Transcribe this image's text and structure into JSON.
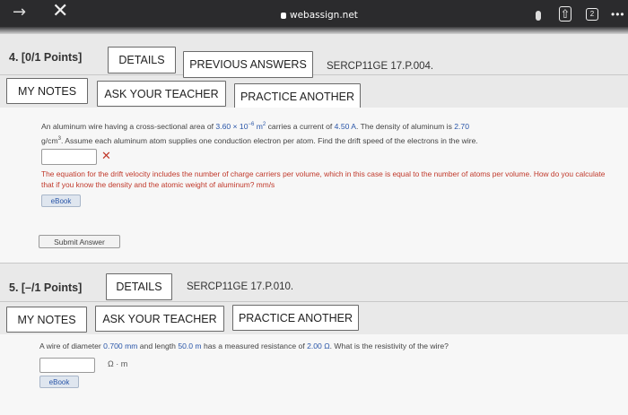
{
  "browser": {
    "url": "webassign.net",
    "share_glyph": "⇧",
    "tabs_count": "2",
    "more": "•••"
  },
  "q4": {
    "title": "4.  [0/1 Points]",
    "details": "DETAILS",
    "previous_answers": "PREVIOUS ANSWERS",
    "code": "SERCP11GE 17.P.004.",
    "my_notes": "MY NOTES",
    "ask_teacher": "ASK YOUR TEACHER",
    "practice": "PRACTICE ANOTHER",
    "text_a": "An aluminum wire having a cross-sectional area of ",
    "area_value": "3.60 × 10",
    "area_exp": "−6",
    "area_unit": " m",
    "area_unit_exp": "2",
    "text_b": " carries a current of ",
    "current": "4.50 A",
    "text_c": ". The density of aluminum is ",
    "density": "2.70",
    "text_d": "g/cm",
    "text_d_exp": "3",
    "text_e": ". Assume each aluminum atom supplies one conduction electron per atom. Find the drift speed of the electrons in the wire.",
    "answer_value": "",
    "feedback": "The equation for the drift velocity includes the number of charge carriers per volume, which in this case is equal to the number of atoms per volume. How do you calculate that if you know the density and the atomic weight of aluminum? mm/s",
    "ebook": "eBook",
    "submit": "Submit Answer"
  },
  "q5": {
    "title": "5.  [–/1 Points]",
    "details": "DETAILS",
    "code": "SERCP11GE 17.P.010.",
    "my_notes": "MY NOTES",
    "ask_teacher": "ASK YOUR TEACHER",
    "practice": "PRACTICE ANOTHER",
    "text_a": "A wire of diameter ",
    "diameter": "0.700 mm",
    "text_b": " and length ",
    "length": "50.0 m",
    "text_c": " has a measured resistance of ",
    "resistance": "2.00 Ω",
    "text_d": ". What is the resistivity of the wire?",
    "answer_value": "",
    "unit": "Ω · m",
    "ebook": "eBook"
  },
  "icons": [
    "back-arrow-icon",
    "close-icon",
    "lock-icon",
    "mic-icon",
    "share-icon",
    "tabs-icon",
    "more-icon",
    "wrong-answer-icon"
  ]
}
